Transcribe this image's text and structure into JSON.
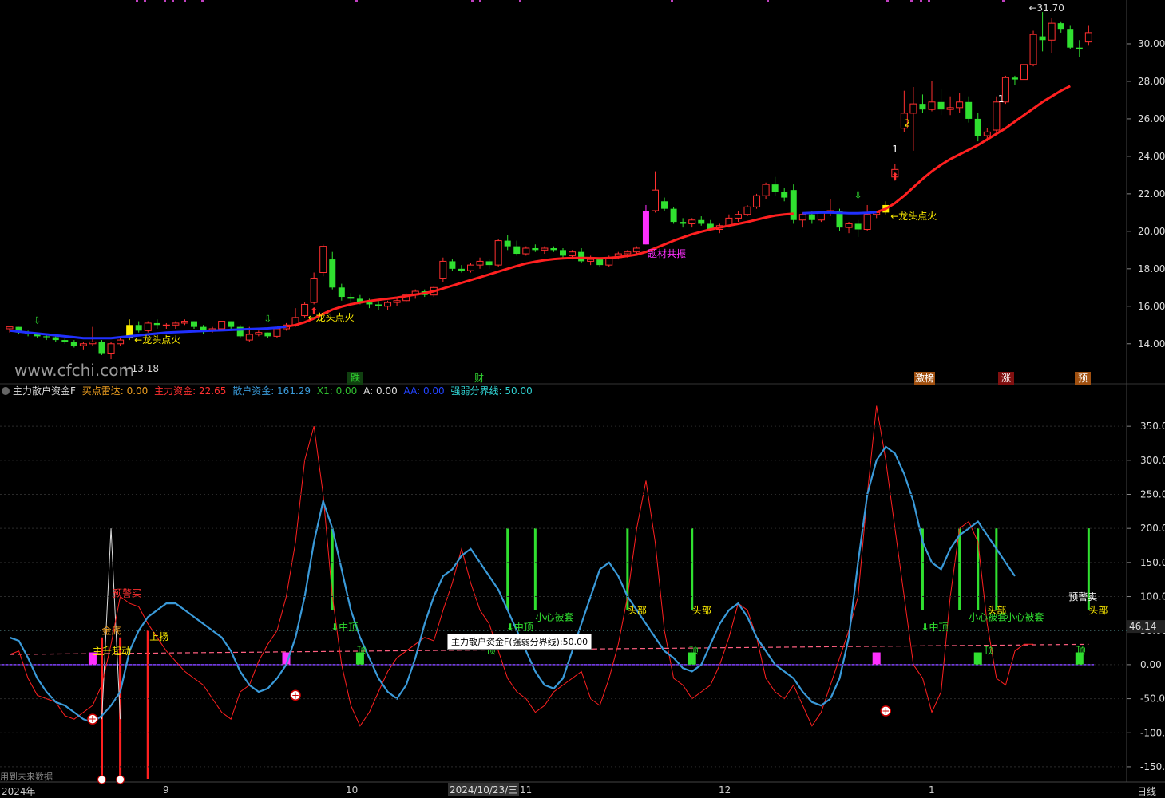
{
  "header": {
    "indicator_name": "主力散户资金F",
    "fields": [
      {
        "label": "买点雷达: 0.00",
        "color": "#f0a020"
      },
      {
        "label": "主力资金: 22.65",
        "color": "#ff3030"
      },
      {
        "label": "散户资金: 161.29",
        "color": "#3a9ad9"
      },
      {
        "label": "X1: 0.00",
        "color": "#30c030"
      },
      {
        "label": "A: 0.00",
        "color": "#dddddd"
      },
      {
        "label": "AA: 0.00",
        "color": "#2244ff"
      },
      {
        "label": "强弱分界线: 50.00",
        "color": "#30d0d0"
      }
    ]
  },
  "watermark": "www.cfchi.com",
  "future_data_note": "用到未来数据",
  "period_label": "日线",
  "current_date": "2024/10/23/三",
  "tooltip": "主力散户资金F(强弱分界线):50.00",
  "indicator_value_badge": "46.14",
  "x_axis_labels": [
    {
      "text": "2024年",
      "key": "y"
    },
    {
      "text": "9",
      "key": "9"
    },
    {
      "text": "10",
      "key": "10"
    },
    {
      "text": "11",
      "key": "11"
    },
    {
      "text": "12",
      "key": "12"
    },
    {
      "text": "1",
      "key": "1"
    }
  ],
  "event_markers": [
    {
      "text": "跌",
      "color": "#30d030",
      "bg": "#104010"
    },
    {
      "text": "财",
      "color": "#30d030",
      "bg": "#000000"
    },
    {
      "text": "激榜",
      "color": "#ffffff",
      "bg": "#a05010"
    },
    {
      "text": "涨",
      "color": "#ffffff",
      "bg": "#801010"
    },
    {
      "text": "预",
      "color": "#ffffff",
      "bg": "#a05010"
    }
  ],
  "price_axis": [
    "30.00",
    "28.00",
    "26.00",
    "24.00",
    "22.00",
    "20.00",
    "18.00",
    "16.00",
    "14.00"
  ],
  "indicator_axis": [
    "350.00",
    "300.00",
    "250.00",
    "200.00",
    "150.00",
    "100.00",
    "50.00",
    "0.00",
    "-50.00",
    "-100.00",
    "-150.00"
  ],
  "price_annotations": {
    "high_label": "31.70",
    "low_label": "13.18",
    "signal_text": "龙头点火",
    "resonance_text": "题材共振",
    "number_labels": [
      "2",
      "1",
      "1"
    ]
  },
  "indicator_annotations": {
    "warn_buy": "预警买",
    "warn_sell": "预警卖",
    "rally_up": "上扬",
    "start": "主升起动",
    "mid_top": "中顶",
    "top": "顶",
    "trapped": "小心被套",
    "head": "头部",
    "bottom_gold": "金底"
  },
  "chart_data": {
    "type": "candlestick",
    "title": "",
    "price_high": 31.7,
    "price_low": 13.18,
    "ylim": [
      12.5,
      32.0
    ],
    "candles": [
      [
        14.8,
        14.9,
        14.6,
        14.9
      ],
      [
        14.9,
        14.9,
        14.5,
        14.6
      ],
      [
        14.6,
        14.7,
        14.4,
        14.5
      ],
      [
        14.5,
        14.6,
        14.3,
        14.4
      ],
      [
        14.4,
        14.5,
        14.2,
        14.35
      ],
      [
        14.35,
        14.4,
        14.1,
        14.2
      ],
      [
        14.2,
        14.3,
        14.0,
        14.1
      ],
      [
        14.1,
        14.2,
        13.8,
        13.9
      ],
      [
        13.9,
        14.1,
        13.7,
        14.0
      ],
      [
        14.0,
        14.9,
        13.9,
        14.1
      ],
      [
        14.1,
        14.2,
        13.4,
        13.5
      ],
      [
        13.5,
        14.1,
        13.18,
        14.0
      ],
      [
        14.0,
        14.3,
        13.9,
        14.2
      ],
      [
        14.3,
        15.3,
        14.2,
        15.0
      ],
      [
        15.0,
        15.2,
        14.6,
        14.7
      ],
      [
        14.7,
        15.2,
        14.6,
        15.1
      ],
      [
        15.1,
        15.3,
        14.8,
        15.0
      ],
      [
        15.0,
        15.1,
        14.8,
        15.0
      ],
      [
        15.0,
        15.2,
        14.8,
        15.1
      ],
      [
        15.1,
        15.3,
        15.0,
        15.2
      ],
      [
        15.2,
        15.2,
        14.8,
        14.9
      ],
      [
        14.9,
        15.0,
        14.5,
        14.7
      ],
      [
        14.7,
        14.9,
        14.6,
        14.8
      ],
      [
        14.8,
        15.2,
        14.7,
        15.2
      ],
      [
        15.2,
        15.2,
        14.8,
        14.9
      ],
      [
        14.9,
        15.0,
        14.3,
        14.4
      ],
      [
        14.2,
        14.9,
        14.1,
        14.5
      ],
      [
        14.5,
        14.7,
        14.4,
        14.6
      ],
      [
        14.6,
        14.6,
        14.3,
        14.4
      ],
      [
        14.4,
        14.8,
        14.3,
        14.8
      ],
      [
        14.8,
        15.1,
        14.7,
        15.0
      ],
      [
        15.0,
        15.9,
        14.9,
        15.4
      ],
      [
        15.5,
        16.2,
        15.4,
        16.1
      ],
      [
        16.2,
        17.8,
        16.1,
        17.5
      ],
      [
        17.8,
        19.3,
        17.6,
        19.2
      ],
      [
        18.5,
        18.9,
        16.9,
        17.0
      ],
      [
        17.0,
        17.2,
        16.3,
        16.5
      ],
      [
        16.5,
        16.7,
        16.1,
        16.4
      ],
      [
        16.4,
        16.6,
        16.1,
        16.2
      ],
      [
        16.2,
        16.4,
        15.9,
        16.1
      ],
      [
        16.1,
        16.3,
        15.8,
        16.0
      ],
      [
        16.0,
        16.3,
        15.8,
        16.2
      ],
      [
        16.2,
        16.5,
        16.0,
        16.3
      ],
      [
        16.3,
        16.7,
        16.2,
        16.6
      ],
      [
        16.6,
        16.9,
        16.4,
        16.8
      ],
      [
        16.8,
        16.9,
        16.5,
        16.6
      ],
      [
        16.6,
        17.1,
        16.5,
        17.0
      ],
      [
        17.5,
        18.6,
        17.3,
        18.4
      ],
      [
        18.4,
        18.5,
        17.9,
        18.0
      ],
      [
        18.0,
        18.2,
        17.8,
        17.9
      ],
      [
        17.9,
        18.3,
        17.8,
        18.2
      ],
      [
        18.2,
        18.6,
        18.0,
        18.4
      ],
      [
        18.4,
        18.5,
        18.0,
        18.2
      ],
      [
        18.2,
        19.6,
        18.1,
        19.5
      ],
      [
        19.5,
        19.8,
        19.0,
        19.2
      ],
      [
        19.2,
        19.5,
        18.7,
        18.8
      ],
      [
        18.8,
        19.2,
        18.7,
        19.1
      ],
      [
        19.1,
        19.3,
        18.9,
        19.0
      ],
      [
        19.0,
        19.2,
        18.8,
        19.1
      ],
      [
        19.1,
        19.2,
        18.9,
        19.0
      ],
      [
        19.0,
        19.1,
        18.6,
        18.7
      ],
      [
        18.7,
        19.0,
        18.5,
        18.9
      ],
      [
        18.9,
        19.1,
        18.3,
        18.4
      ],
      [
        18.4,
        18.7,
        18.2,
        18.5
      ],
      [
        18.5,
        18.6,
        18.1,
        18.2
      ],
      [
        18.2,
        18.7,
        18.1,
        18.6
      ],
      [
        18.6,
        18.9,
        18.5,
        18.8
      ],
      [
        18.8,
        19.0,
        18.6,
        18.9
      ],
      [
        18.9,
        19.2,
        18.8,
        19.1
      ],
      [
        19.3,
        21.4,
        19.3,
        21.1
      ],
      [
        21.1,
        23.2,
        21.0,
        22.2
      ],
      [
        21.6,
        21.8,
        21.1,
        21.2
      ],
      [
        21.2,
        21.3,
        20.4,
        20.5
      ],
      [
        20.5,
        20.7,
        20.2,
        20.4
      ],
      [
        20.4,
        20.7,
        20.2,
        20.6
      ],
      [
        20.6,
        20.8,
        20.3,
        20.4
      ],
      [
        20.4,
        20.6,
        20.0,
        20.1
      ],
      [
        20.1,
        20.4,
        19.9,
        20.3
      ],
      [
        20.3,
        20.9,
        20.2,
        20.7
      ],
      [
        20.7,
        21.1,
        20.5,
        20.9
      ],
      [
        20.9,
        21.4,
        20.8,
        21.3
      ],
      [
        21.3,
        22.0,
        21.2,
        21.9
      ],
      [
        21.9,
        22.6,
        21.7,
        22.5
      ],
      [
        22.5,
        22.9,
        21.9,
        22.1
      ],
      [
        22.1,
        22.3,
        21.6,
        21.8
      ],
      [
        22.2,
        22.5,
        20.4,
        20.6
      ],
      [
        20.6,
        21.0,
        20.2,
        20.9
      ],
      [
        20.9,
        21.1,
        20.4,
        20.6
      ],
      [
        20.6,
        21.1,
        20.5,
        21.0
      ],
      [
        21.1,
        21.7,
        20.8,
        21.1
      ],
      [
        21.1,
        21.2,
        20.0,
        20.2
      ],
      [
        20.2,
        20.5,
        19.9,
        20.4
      ],
      [
        20.4,
        20.6,
        19.7,
        20.1
      ],
      [
        20.1,
        21.4,
        20.0,
        20.9
      ],
      [
        20.9,
        21.1,
        20.7,
        21.0
      ],
      [
        21.0,
        21.6,
        20.9,
        21.4
      ],
      [
        22.9,
        23.6,
        22.7,
        23.3
      ],
      [
        25.5,
        27.5,
        25.3,
        26.3
      ],
      [
        26.3,
        27.7,
        24.3,
        26.8
      ],
      [
        26.8,
        27.3,
        26.3,
        26.5
      ],
      [
        26.5,
        28.0,
        26.4,
        26.9
      ],
      [
        26.9,
        27.6,
        26.2,
        26.5
      ],
      [
        26.5,
        27.2,
        26.2,
        26.6
      ],
      [
        26.6,
        27.4,
        26.3,
        26.9
      ],
      [
        26.9,
        27.2,
        25.8,
        26.0
      ],
      [
        26.0,
        26.3,
        24.8,
        25.1
      ],
      [
        25.1,
        25.5,
        24.8,
        25.3
      ],
      [
        25.4,
        27.2,
        25.3,
        26.9
      ],
      [
        26.9,
        28.3,
        26.8,
        28.2
      ],
      [
        28.2,
        28.3,
        27.8,
        28.1
      ],
      [
        28.1,
        29.4,
        27.9,
        28.9
      ],
      [
        28.9,
        30.7,
        28.8,
        30.5
      ],
      [
        30.4,
        31.7,
        29.6,
        30.2
      ],
      [
        30.2,
        31.4,
        29.5,
        31.1
      ],
      [
        31.1,
        31.2,
        30.6,
        30.8
      ],
      [
        30.8,
        31.0,
        29.7,
        29.8
      ],
      [
        29.8,
        30.2,
        29.3,
        29.7
      ],
      [
        30.1,
        31.0,
        29.9,
        30.6
      ]
    ],
    "ma": [
      14.7,
      14.65,
      14.6,
      14.55,
      14.5,
      14.45,
      14.4,
      14.35,
      14.3,
      14.3,
      14.3,
      14.3,
      14.35,
      14.4,
      14.45,
      14.5,
      14.55,
      14.6,
      14.62,
      14.64,
      14.66,
      14.68,
      14.7,
      14.72,
      14.74,
      14.76,
      14.78,
      14.8,
      14.82,
      14.86,
      14.92,
      15.0,
      15.15,
      15.35,
      15.6,
      15.82,
      15.98,
      16.1,
      16.2,
      16.28,
      16.34,
      16.4,
      16.46,
      16.54,
      16.62,
      16.7,
      16.8,
      16.95,
      17.1,
      17.25,
      17.4,
      17.55,
      17.7,
      17.85,
      18.0,
      18.15,
      18.28,
      18.38,
      18.46,
      18.52,
      18.56,
      18.58,
      18.58,
      18.57,
      18.56,
      18.58,
      18.62,
      18.68,
      18.76,
      18.9,
      19.1,
      19.3,
      19.5,
      19.68,
      19.84,
      19.98,
      20.1,
      20.2,
      20.3,
      20.4,
      20.5,
      20.62,
      20.74,
      20.84,
      20.9,
      20.94,
      20.96,
      20.98,
      21.0,
      21.0,
      20.98,
      20.96,
      20.96,
      20.98,
      21.02,
      21.2,
      21.5,
      21.9,
      22.35,
      22.8,
      23.2,
      23.55,
      23.85,
      24.1,
      24.35,
      24.6,
      24.9,
      25.2,
      25.5,
      25.85,
      26.2,
      26.55,
      26.9,
      27.2,
      27.5,
      27.75
    ],
    "main_funds": [
      15,
      20,
      -20,
      -45,
      -50,
      -55,
      -75,
      -80,
      -70,
      -60,
      -30,
      30,
      100,
      90,
      85,
      60,
      40,
      20,
      5,
      -10,
      -20,
      -30,
      -50,
      -70,
      -80,
      -40,
      -30,
      5,
      30,
      50,
      100,
      180,
      300,
      350,
      250,
      100,
      0,
      -60,
      -90,
      -70,
      -40,
      -10,
      10,
      20,
      30,
      40,
      35,
      80,
      120,
      170,
      120,
      80,
      60,
      20,
      -20,
      -40,
      -50,
      -70,
      -60,
      -40,
      -30,
      -20,
      -10,
      -50,
      -60,
      -20,
      30,
      100,
      200,
      270,
      180,
      50,
      -20,
      -30,
      -50,
      -40,
      -30,
      0,
      40,
      90,
      80,
      40,
      -20,
      -40,
      -50,
      -30,
      -60,
      -90,
      -70,
      -30,
      10,
      50,
      100,
      250,
      380,
      300,
      200,
      100,
      0,
      -20,
      -70,
      -40,
      100,
      200,
      210,
      180,
      60,
      -20,
      -30,
      20,
      30,
      30
    ],
    "retail_funds": [
      40,
      35,
      10,
      -20,
      -40,
      -55,
      -60,
      -70,
      -80,
      -85,
      -75,
      -60,
      -40,
      20,
      50,
      70,
      80,
      90,
      90,
      80,
      70,
      60,
      50,
      40,
      20,
      -10,
      -30,
      -40,
      -35,
      -20,
      0,
      40,
      100,
      180,
      240,
      200,
      140,
      80,
      40,
      10,
      -20,
      -40,
      -50,
      -30,
      10,
      60,
      100,
      130,
      140,
      160,
      170,
      150,
      130,
      110,
      80,
      50,
      20,
      -10,
      -30,
      -35,
      -20,
      20,
      60,
      100,
      140,
      150,
      130,
      100,
      80,
      60,
      40,
      20,
      10,
      -5,
      -10,
      0,
      30,
      60,
      80,
      90,
      70,
      40,
      20,
      0,
      -10,
      -20,
      -40,
      -55,
      -60,
      -50,
      -20,
      40,
      150,
      250,
      300,
      320,
      310,
      280,
      240,
      180,
      150,
      140,
      170,
      190,
      200,
      210,
      190,
      170,
      150,
      130
    ],
    "divide_line": 50,
    "indicator_ylim": [
      -170,
      390
    ]
  }
}
